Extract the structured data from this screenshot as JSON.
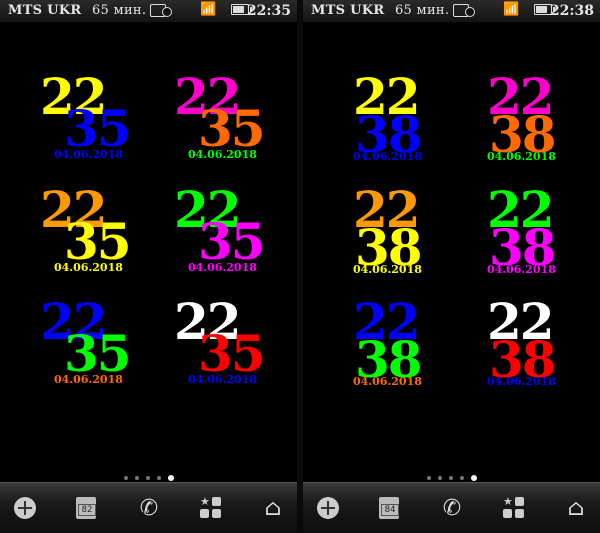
{
  "screens": [
    {
      "operator": "MTS UKR",
      "balance": "65 мин.",
      "status_time": "22:35",
      "widgets": [
        {
          "hour": "22",
          "minute": "35",
          "date": "04.06.2018",
          "hour_color": "#ffff00",
          "minute_color": "#0000ff",
          "date_color": "#0000ff"
        },
        {
          "hour": "22",
          "minute": "35",
          "date": "04.06.2018",
          "hour_color": "#ff00cc",
          "minute_color": "#ff6a00",
          "date_color": "#00ff00"
        },
        {
          "hour": "22",
          "minute": "35",
          "date": "04.06.2018",
          "hour_color": "#ff9900",
          "minute_color": "#ffff00",
          "date_color": "#ffff00"
        },
        {
          "hour": "22",
          "minute": "35",
          "date": "04.06.2018",
          "hour_color": "#00ff00",
          "minute_color": "#ff00ff",
          "date_color": "#ff00ff"
        },
        {
          "hour": "22",
          "minute": "35",
          "date": "04.06.2018",
          "hour_color": "#0000ff",
          "minute_color": "#00ff00",
          "date_color": "#ff6a00"
        },
        {
          "hour": "22",
          "minute": "35",
          "date": "04.06.2018",
          "hour_color": "#ffffff",
          "minute_color": "#ff0000",
          "date_color": "#0000ff"
        }
      ],
      "calendar_day": "82",
      "active_page": 5
    },
    {
      "operator": "MTS UKR",
      "balance": "65 мин.",
      "status_time": "22:38",
      "widgets": [
        {
          "hour": "22",
          "minute": "38",
          "date": "04.06.2018",
          "hour_color": "#ffff00",
          "minute_color": "#0000ff",
          "date_color": "#0000ff"
        },
        {
          "hour": "22",
          "minute": "38",
          "date": "04.06.2018",
          "hour_color": "#ff00cc",
          "minute_color": "#ff6a00",
          "date_color": "#00ff00"
        },
        {
          "hour": "22",
          "minute": "38",
          "date": "04.06.2018",
          "hour_color": "#ff9900",
          "minute_color": "#ffff00",
          "date_color": "#ffff00"
        },
        {
          "hour": "22",
          "minute": "38",
          "date": "04.06.2018",
          "hour_color": "#00ff00",
          "minute_color": "#ff00ff",
          "date_color": "#ff00ff"
        },
        {
          "hour": "22",
          "minute": "38",
          "date": "04.06.2018",
          "hour_color": "#0000ff",
          "minute_color": "#00ff00",
          "date_color": "#ff6a00"
        },
        {
          "hour": "22",
          "minute": "38",
          "date": "04.06.2018",
          "hour_color": "#ffffff",
          "minute_color": "#ff0000",
          "date_color": "#0000ff"
        }
      ],
      "calendar_day": "84",
      "active_page": 5
    }
  ],
  "page_indicator_count": 5,
  "dock_icons": [
    "windows-start-icon",
    "calendar-icon",
    "phone-icon",
    "apps-grid-icon",
    "home-icon"
  ]
}
